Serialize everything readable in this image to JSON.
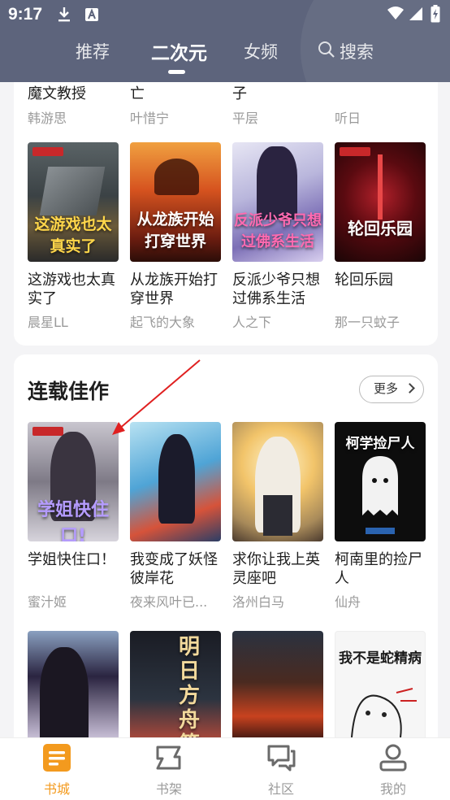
{
  "status_bar": {
    "time": "9:17"
  },
  "top_tabs": [
    {
      "label": "推荐"
    },
    {
      "label": "二次元"
    },
    {
      "label": "女频"
    },
    {
      "label": "搜索"
    }
  ],
  "top_section": {
    "partial_row": [
      {
        "title": "魔文教授",
        "author": "韩游思"
      },
      {
        "title": "亡",
        "author": "叶惜宁"
      },
      {
        "title": "子",
        "author": "平层"
      },
      {
        "title": "",
        "author": "听日"
      }
    ],
    "books": [
      {
        "title": "这游戏也太真实了",
        "author": "晨星LL",
        "cover_text": "这游戏也太真实了"
      },
      {
        "title": "从龙族开始打穿世界",
        "author": "起飞的大象",
        "cover_text": "从龙族开始打穿世界"
      },
      {
        "title": "反派少爷只想过佛系生活",
        "author": "人之下",
        "cover_text": "反派少爷只想过佛系生活"
      },
      {
        "title": "轮回乐园",
        "author": "那一只蚊子",
        "cover_text": "轮回乐园"
      }
    ]
  },
  "serial_section": {
    "title": "连载佳作",
    "more_label": "更多",
    "books": [
      {
        "title": "学姐快住口！",
        "author": "蜜汁姬",
        "cover_text": "学姐快住口!"
      },
      {
        "title": "我变成了妖怪彼岸花",
        "author": "夜来风叶已...",
        "cover_text": ""
      },
      {
        "title": "求你让我上英灵座吧",
        "author": "洛州白马",
        "cover_text": ""
      },
      {
        "title": "柯南里的捡尸人",
        "author": "仙舟",
        "cover_text": "柯学捡尸人"
      }
    ],
    "next_row_covers": [
      {
        "cover_text": ""
      },
      {
        "cover_text": "明日方舟 第二国度"
      },
      {
        "cover_text": ""
      },
      {
        "cover_text": "我不是蛇精病"
      }
    ]
  },
  "bottom_nav": [
    {
      "label": "书城",
      "icon": "book-store-icon",
      "active": true
    },
    {
      "label": "书架",
      "icon": "bookshelf-icon",
      "active": false
    },
    {
      "label": "社区",
      "icon": "community-chat-icon",
      "active": false
    },
    {
      "label": "我的",
      "icon": "profile-icon",
      "active": false
    }
  ],
  "colors": {
    "accent": "#f39a1e",
    "header": "#5d647c",
    "annotation_arrow": "#e02020"
  }
}
